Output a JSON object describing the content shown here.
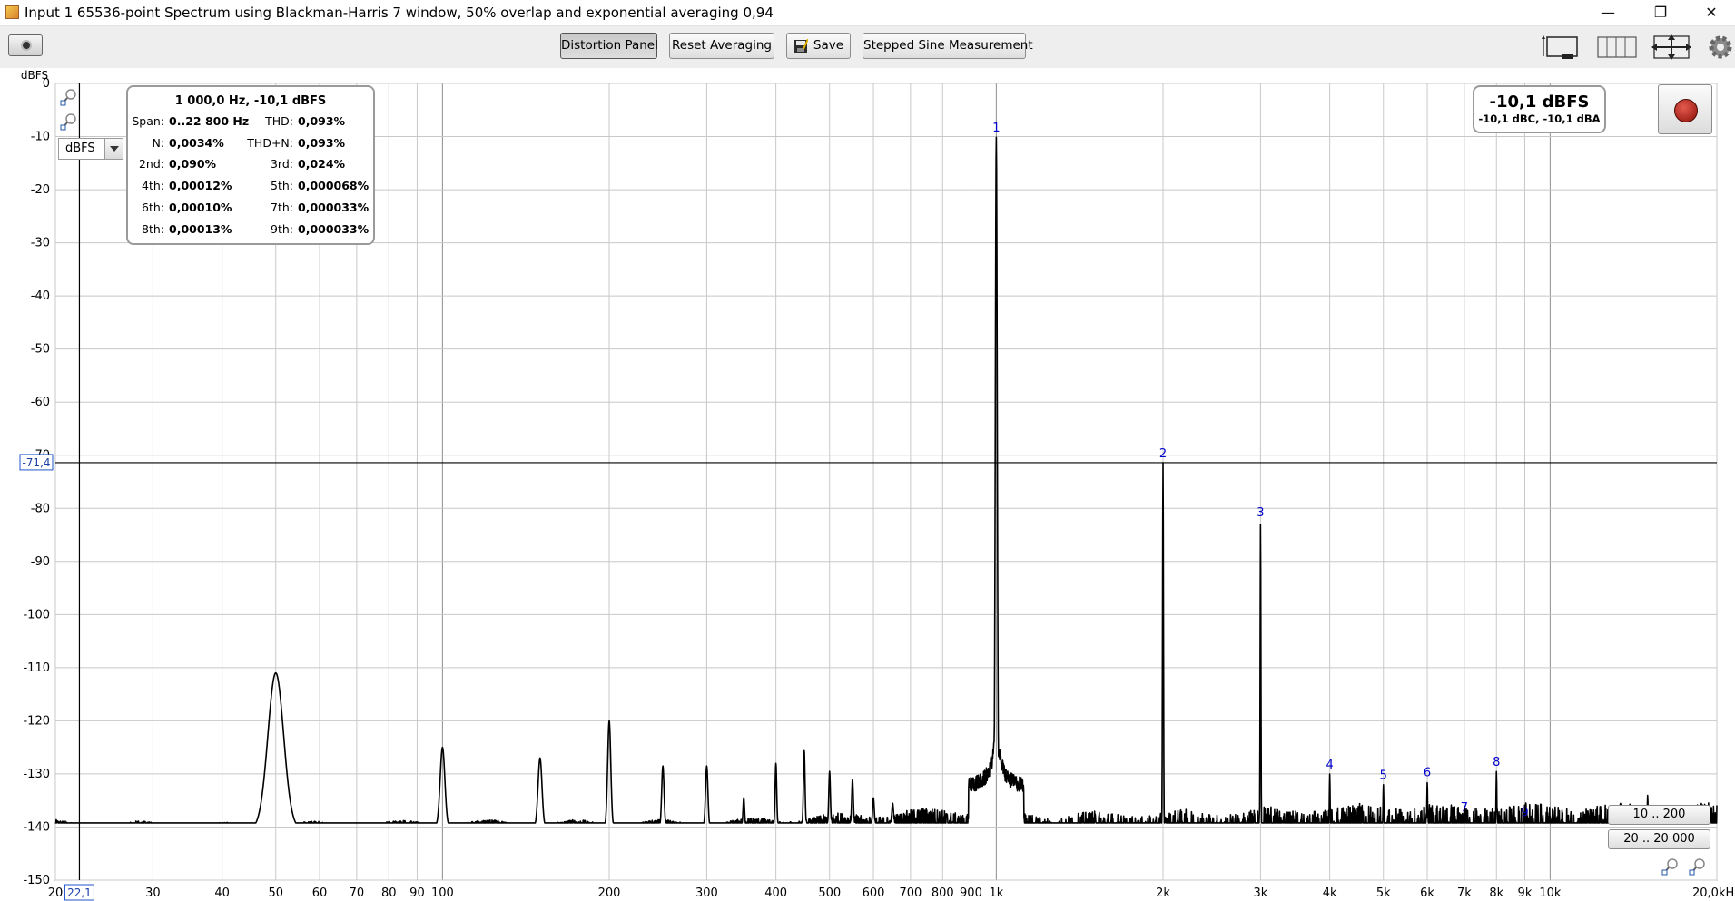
{
  "window": {
    "title": "Input 1 65536-point Spectrum using Blackman-Harris 7 window, 50% overlap and exponential averaging 0,94",
    "minimize": "—",
    "maximize": "❐",
    "close": "✕"
  },
  "toolbar": {
    "distortion_panel": "Distortion Panel",
    "reset_averaging": "Reset Averaging",
    "save": "Save",
    "stepped_sine": "Stepped Sine Measurement"
  },
  "info_panel": {
    "header": "1 000,0 Hz, -10,1 dBFS",
    "rows": [
      [
        {
          "label": "Span:",
          "value": "0..22 800 Hz"
        },
        {
          "label": "THD:",
          "value": "0,093%"
        }
      ],
      [
        {
          "label": "N:",
          "value": "0,0034%"
        },
        {
          "label": "THD+N:",
          "value": "0,093%"
        }
      ],
      [
        {
          "label": "2nd:",
          "value": "0,090%"
        },
        {
          "label": "3rd:",
          "value": "0,024%"
        }
      ],
      [
        {
          "label": "4th:",
          "value": "0,00012%"
        },
        {
          "label": "5th:",
          "value": "0,000068%"
        }
      ],
      [
        {
          "label": "6th:",
          "value": "0,00010%"
        },
        {
          "label": "7th:",
          "value": "0,000033%"
        }
      ],
      [
        {
          "label": "8th:",
          "value": "0,00013%"
        },
        {
          "label": "9th:",
          "value": "0,000033%"
        }
      ]
    ]
  },
  "level_meter": {
    "main": "-10,1 dBFS",
    "sub": "-10,1 dBC, -10,1 dBA"
  },
  "unit_select": {
    "value": "dBFS"
  },
  "range_buttons": [
    "10 .. 200",
    "20 .. 20 000"
  ],
  "chart_data": {
    "type": "line",
    "ylabel": "dBFS",
    "ylim": [
      -150,
      0
    ],
    "y_ticks": [
      0,
      -10,
      -20,
      -30,
      -40,
      -50,
      -60,
      -70,
      -80,
      -90,
      -100,
      -110,
      -120,
      -130,
      -140,
      -150
    ],
    "xlim": [
      20,
      20000
    ],
    "x_scale": "log",
    "x_tick_labels": [
      {
        "value": 20,
        "label": "20"
      },
      {
        "value": 30,
        "label": "30"
      },
      {
        "value": 40,
        "label": "40"
      },
      {
        "value": 50,
        "label": "50"
      },
      {
        "value": 60,
        "label": "60"
      },
      {
        "value": 70,
        "label": "70"
      },
      {
        "value": 80,
        "label": "80"
      },
      {
        "value": 90,
        "label": "90"
      },
      {
        "value": 100,
        "label": "100"
      },
      {
        "value": 200,
        "label": "200"
      },
      {
        "value": 300,
        "label": "300"
      },
      {
        "value": 400,
        "label": "400"
      },
      {
        "value": 500,
        "label": "500"
      },
      {
        "value": 600,
        "label": "600"
      },
      {
        "value": 700,
        "label": "700"
      },
      {
        "value": 800,
        "label": "800"
      },
      {
        "value": 900,
        "label": "900"
      },
      {
        "value": 1000,
        "label": "1k"
      },
      {
        "value": 2000,
        "label": "2k"
      },
      {
        "value": 3000,
        "label": "3k"
      },
      {
        "value": 4000,
        "label": "4k"
      },
      {
        "value": 5000,
        "label": "5k"
      },
      {
        "value": 6000,
        "label": "6k"
      },
      {
        "value": 7000,
        "label": "7k"
      },
      {
        "value": 8000,
        "label": "8k"
      },
      {
        "value": 9000,
        "label": "9k"
      },
      {
        "value": 10000,
        "label": "10k"
      },
      {
        "value": 20000,
        "label": "20,0kHz"
      }
    ],
    "cursor": {
      "x": 22.1,
      "x_label": "22,1",
      "y": -71.4,
      "y_label": "-71,4"
    },
    "grid": true,
    "noise_floor": [
      [
        20,
        -140
      ],
      [
        40,
        -140.5
      ],
      [
        100,
        -140
      ],
      [
        300,
        -140
      ],
      [
        500,
        -139.5
      ],
      [
        800,
        -139
      ],
      [
        1200,
        -140.5
      ],
      [
        2000,
        -141
      ],
      [
        5000,
        -141
      ],
      [
        10000,
        -141
      ],
      [
        20000,
        -141
      ]
    ],
    "peaks": [
      {
        "x": 50,
        "y": -111,
        "width": 0.02
      },
      {
        "x": 100,
        "y": -125,
        "width": 0.006
      },
      {
        "x": 150,
        "y": -127,
        "width": 0.005
      },
      {
        "x": 200,
        "y": -120,
        "width": 0.004
      },
      {
        "x": 250,
        "y": -128.5,
        "width": 0.003
      },
      {
        "x": 300,
        "y": -128.5,
        "width": 0.003
      },
      {
        "x": 350,
        "y": -134.5,
        "width": 0.002
      },
      {
        "x": 400,
        "y": -128,
        "width": 0.002
      },
      {
        "x": 450,
        "y": -125.5,
        "width": 0.002
      },
      {
        "x": 500,
        "y": -129.5,
        "width": 0.002
      },
      {
        "x": 550,
        "y": -131,
        "width": 0.002
      },
      {
        "x": 600,
        "y": -134.5,
        "width": 0.002
      },
      {
        "x": 650,
        "y": -135.5,
        "width": 0.002
      },
      {
        "x": 1000,
        "y": -10.1,
        "width": 0.0025
      },
      {
        "x": 2000,
        "y": -71.4,
        "width": 0.0012
      },
      {
        "x": 3000,
        "y": -82.5,
        "width": 0.001
      },
      {
        "x": 4000,
        "y": -130,
        "width": 0.001
      },
      {
        "x": 5000,
        "y": -132,
        "width": 0.001
      },
      {
        "x": 6000,
        "y": -131.5,
        "width": 0.001
      },
      {
        "x": 7000,
        "y": -138,
        "width": 0.001
      },
      {
        "x": 8000,
        "y": -129.5,
        "width": 0.001
      },
      {
        "x": 9000,
        "y": -139,
        "width": 0.001
      },
      {
        "x": 15000,
        "y": -134,
        "width": 0.001
      }
    ],
    "harmonic_markers": [
      {
        "label": "1",
        "x": 1000,
        "y": -10.1
      },
      {
        "label": "2",
        "x": 2000,
        "y": -71.4
      },
      {
        "label": "3",
        "x": 3000,
        "y": -82.5
      },
      {
        "label": "4",
        "x": 4000,
        "y": -130
      },
      {
        "label": "5",
        "x": 5000,
        "y": -132
      },
      {
        "label": "6",
        "x": 6000,
        "y": -131.5
      },
      {
        "label": "7",
        "x": 7000,
        "y": -138
      },
      {
        "label": "8",
        "x": 8000,
        "y": -129.5
      },
      {
        "label": "9",
        "x": 9000,
        "y": -139
      }
    ],
    "colors": {
      "trace": "#000000",
      "grid": "#c8c8c8",
      "marker": "#0000cc",
      "cursor": "#000000"
    }
  }
}
